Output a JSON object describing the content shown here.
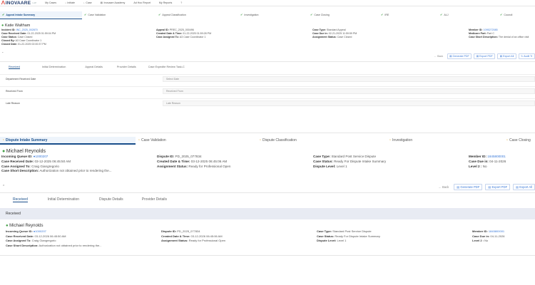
{
  "nav": {
    "logo": "INOVAARE",
    "logo_sub": "I-AP",
    "items": [
      {
        "label": "My Cases",
        "icon": ""
      },
      {
        "label": "Initiate",
        "icon": "↓"
      },
      {
        "label": "Case",
        "icon": "↓"
      },
      {
        "label": "Inovaare Academy",
        "icon": "▤"
      },
      {
        "label": "Ad Hoc Report",
        "icon": ""
      },
      {
        "label": "My Reports",
        "icon": ""
      },
      {
        "label": "",
        "icon": "?"
      }
    ]
  },
  "steps_top": [
    "Appeal Intake Summary",
    "Case Validation",
    "Appeal Classification",
    "Investigation",
    "Case Closing",
    "IRE",
    "ALJ",
    "Council"
  ],
  "steps_bottom": [
    "Dispute Intake Summary",
    "Case Validation",
    "Dispute Classification",
    "Investigation",
    "Case Closing"
  ],
  "top_case": {
    "person": "Katie Waltham",
    "incident_id_label": "Incident ID:",
    "incident_id": "INC_2025_002870",
    "received_label": "Case Received Date:",
    "received": "01-22-2025 01:59:04 PM",
    "case_status_label": "Case Status:",
    "case_status": "Case Closed",
    "closed_by_label": "Closed By:",
    "closed_by": "A3 Case Coordinator 1",
    "closed_date_label": "Closed Date:",
    "closed_date": "01-22-2025 02:00:37 PM",
    "appeal_id_label": "Appeal ID:",
    "appeal_id": "PREC_2025_000496",
    "created_label": "Created Date & Time:",
    "created": "01-22-2025 01:59:28 PM",
    "assigned_label": "Case Assigned To:",
    "assigned": "A3 Case Coordinator 1",
    "type_label": "Case Type:",
    "type": "Standard Appeal",
    "due_label": "Case Due in:",
    "due": "02-21-2025 11:59:59 PM",
    "astatus_label": "Assignment Status:",
    "astatus": "Case Closed",
    "member_label": "Member ID:",
    "member": "1095272085",
    "medicare_label": "Medicare Part:",
    "medicare": "Part C",
    "desc_label": "Case Short Description:",
    "desc": "The denial of an office visit"
  },
  "top_actions": {
    "back": "Back",
    "generate": "Generate PDF",
    "export_pdf": "Export PDF",
    "export_all": "Export All",
    "audit": "Audit Tr"
  },
  "top_tabs": [
    "Received",
    "Initial Determination",
    "Appeal Details",
    "Provider Details",
    "Case Expedite Review Task-C"
  ],
  "form": [
    {
      "label": "Department Received Date",
      "placeholder": "Select Date"
    },
    {
      "label": "Received From",
      "placeholder": "Received From"
    },
    {
      "label": "Late Reason",
      "placeholder": "Late Reason"
    }
  ],
  "mid_case": {
    "person": "Michael Reynolds",
    "queue_label": "Incoming Queue ID:",
    "queue": "1000207",
    "received_label": "Case Received Date:",
    "received": "03-12-2025 06:45:50 AM",
    "assigned_label": "Case Assigned To:",
    "assigned": "Craig Giangregorio",
    "desc_label": "Case Short Description:",
    "desc": "Authorization not obtained prior to rendering the...",
    "dispute_label": "Dispute ID:",
    "dispute": "PD_2025_077834",
    "created_label": "Created Date & Time:",
    "created": "03-12-2025 06:45:06 AM",
    "astatus_label": "Assignment Status:",
    "astatus": "Ready for Professional Open",
    "type_label": "Case Type:",
    "type": "Standard Post Service Dispute",
    "status_label": "Case Status:",
    "status": "Ready For Dispute Intake Summary",
    "level_label": "Dispute Level:",
    "level": "Level 1",
    "member_label": "Member ID:",
    "member": "1845800001",
    "due_label": "Case Due in:",
    "due": "04-11-2026",
    "level2_label": "Level 2 :",
    "level2": "No"
  },
  "mid_actions": {
    "back": "Back",
    "generate": "Generate PDF",
    "export_pdf": "Export PDF",
    "export_all": "Export All"
  },
  "mid_tabs": [
    "Received",
    "Initial Determination",
    "Dispute Details",
    "Provider Details"
  ],
  "received_bar": "Received",
  "bottom_case": {
    "person": "Michael Reynolds",
    "queue_label": "Incoming Queue ID:",
    "queue": "1000207",
    "received_label": "Case Received Date:",
    "received": "03-12-2026 06:45:50 AM",
    "assigned_label": "Case Assigned To:",
    "assigned": "Craig Giangregorio",
    "desc_label": "Case Short Description:",
    "desc": "Authorization not obtained prior to rendering the...",
    "dispute_label": "Dispute ID:",
    "dispute": "PD_2025_077834",
    "created_label": "Created Date & Time:",
    "created": "03-12-2026 06:45:06 AM",
    "astatus_label": "Assignment Status:",
    "astatus": "Ready for Professional Open",
    "type_label": "Case Type:",
    "type": "Standard Post Service Dispute",
    "status_label": "Case Status:",
    "status": "Ready For Dispute Intake Summary",
    "level_label": "Dispute Level:",
    "level": "Level 1",
    "member_label": "Member ID:",
    "member": "1845800001",
    "due_label": "Case Due in:",
    "due": "04-11-2026",
    "level2_label": "Level 2 :",
    "level2": "No"
  }
}
